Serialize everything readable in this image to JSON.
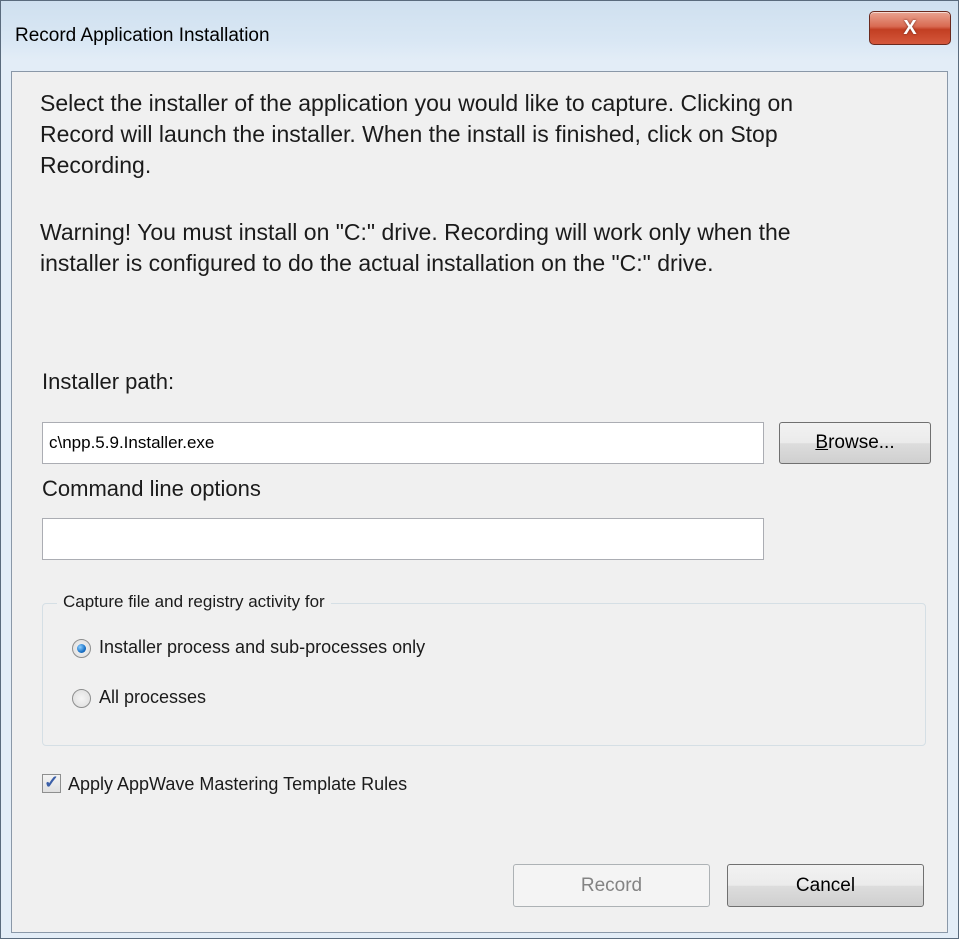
{
  "window": {
    "title": "Record Application Installation",
    "close_glyph": "X"
  },
  "intro": {
    "line1": "Select the installer of the application you would like to capture.  Clicking on",
    "line2": "Record will  launch the installer.  When the install is finished, click on Stop",
    "line3": "Recording.",
    "warning1": "Warning! You must install on \"C:\" drive. Recording will work only when the",
    "warning2": "installer is configured to do the actual installation on the \"C:\" drive."
  },
  "installer_path": {
    "label": "Installer path:",
    "value": "c\\npp.5.9.Installer.exe"
  },
  "browse_button": {
    "mnemonic": "B",
    "rest": "rowse..."
  },
  "command_line": {
    "label": "Command line options",
    "value": ""
  },
  "capture_group": {
    "legend": "Capture file and registry activity for",
    "options": [
      {
        "label": "Installer process and sub-processes only",
        "selected": true
      },
      {
        "label": "All processes",
        "selected": false
      }
    ]
  },
  "mastering_checkbox": {
    "label": "Apply AppWave Mastering Template Rules",
    "checked": true
  },
  "buttons": {
    "record": "Record",
    "cancel": "Cancel"
  },
  "colors": {
    "close_button": "#c7452a",
    "radio_dot": "#1a73c9",
    "client_bg": "#f0f0f0"
  }
}
